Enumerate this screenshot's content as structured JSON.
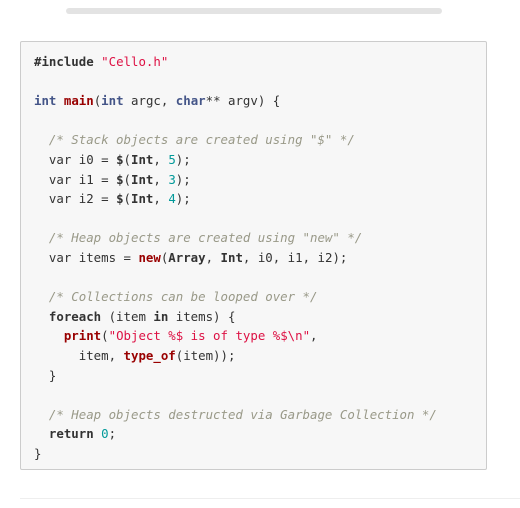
{
  "code_lines": [
    [
      {
        "text": "#include",
        "kind": "k"
      },
      {
        "text": " ",
        "kind": "p"
      },
      {
        "text": "\"Cello.h\"",
        "kind": "s"
      }
    ],
    [],
    [
      {
        "text": "int",
        "kind": "t"
      },
      {
        "text": " ",
        "kind": "p"
      },
      {
        "text": "main",
        "kind": "f"
      },
      {
        "text": "(",
        "kind": "p"
      },
      {
        "text": "int",
        "kind": "t"
      },
      {
        "text": " argc, ",
        "kind": "p"
      },
      {
        "text": "char",
        "kind": "t"
      },
      {
        "text": "** argv) {",
        "kind": "p"
      }
    ],
    [],
    [
      {
        "text": "  ",
        "kind": "p"
      },
      {
        "text": "/* Stack objects are created using \"$\" */",
        "kind": "c"
      }
    ],
    [
      {
        "text": "  var i0 = ",
        "kind": "p"
      },
      {
        "text": "$",
        "kind": "k"
      },
      {
        "text": "(",
        "kind": "p"
      },
      {
        "text": "Int",
        "kind": "k"
      },
      {
        "text": ", ",
        "kind": "p"
      },
      {
        "text": "5",
        "kind": "n"
      },
      {
        "text": ");",
        "kind": "p"
      }
    ],
    [
      {
        "text": "  var i1 = ",
        "kind": "p"
      },
      {
        "text": "$",
        "kind": "k"
      },
      {
        "text": "(",
        "kind": "p"
      },
      {
        "text": "Int",
        "kind": "k"
      },
      {
        "text": ", ",
        "kind": "p"
      },
      {
        "text": "3",
        "kind": "n"
      },
      {
        "text": ");",
        "kind": "p"
      }
    ],
    [
      {
        "text": "  var i2 = ",
        "kind": "p"
      },
      {
        "text": "$",
        "kind": "k"
      },
      {
        "text": "(",
        "kind": "p"
      },
      {
        "text": "Int",
        "kind": "k"
      },
      {
        "text": ", ",
        "kind": "p"
      },
      {
        "text": "4",
        "kind": "n"
      },
      {
        "text": ");",
        "kind": "p"
      }
    ],
    [],
    [
      {
        "text": "  ",
        "kind": "p"
      },
      {
        "text": "/* Heap objects are created using \"new\" */",
        "kind": "c"
      }
    ],
    [
      {
        "text": "  var items = ",
        "kind": "p"
      },
      {
        "text": "new",
        "kind": "f"
      },
      {
        "text": "(",
        "kind": "p"
      },
      {
        "text": "Array",
        "kind": "k"
      },
      {
        "text": ", ",
        "kind": "p"
      },
      {
        "text": "Int",
        "kind": "k"
      },
      {
        "text": ", i0, i1, i2);",
        "kind": "p"
      }
    ],
    [],
    [
      {
        "text": "  ",
        "kind": "p"
      },
      {
        "text": "/* Collections can be looped over */",
        "kind": "c"
      }
    ],
    [
      {
        "text": "  ",
        "kind": "p"
      },
      {
        "text": "foreach",
        "kind": "k"
      },
      {
        "text": " (item ",
        "kind": "p"
      },
      {
        "text": "in",
        "kind": "k"
      },
      {
        "text": " items) {",
        "kind": "p"
      }
    ],
    [
      {
        "text": "    ",
        "kind": "p"
      },
      {
        "text": "print",
        "kind": "f"
      },
      {
        "text": "(",
        "kind": "p"
      },
      {
        "text": "\"Object %$ is of type %$\\n\"",
        "kind": "s"
      },
      {
        "text": ",",
        "kind": "p"
      }
    ],
    [
      {
        "text": "      item, ",
        "kind": "p"
      },
      {
        "text": "type_of",
        "kind": "f"
      },
      {
        "text": "(item));",
        "kind": "p"
      }
    ],
    [
      {
        "text": "  }",
        "kind": "p"
      }
    ],
    [],
    [
      {
        "text": "  ",
        "kind": "p"
      },
      {
        "text": "/* Heap objects destructed via Garbage Collection */",
        "kind": "c"
      }
    ],
    [
      {
        "text": "  ",
        "kind": "p"
      },
      {
        "text": "return",
        "kind": "k"
      },
      {
        "text": " ",
        "kind": "p"
      },
      {
        "text": "0",
        "kind": "n"
      },
      {
        "text": ";",
        "kind": "p"
      }
    ],
    [
      {
        "text": "}",
        "kind": "p"
      }
    ]
  ],
  "colors": {
    "code_background": "#f7f7f7",
    "code_border": "#cccccc",
    "comment": "#999988",
    "string": "#dd1144",
    "function": "#990000",
    "type": "#445588",
    "number": "#009999",
    "text": "#333333"
  }
}
